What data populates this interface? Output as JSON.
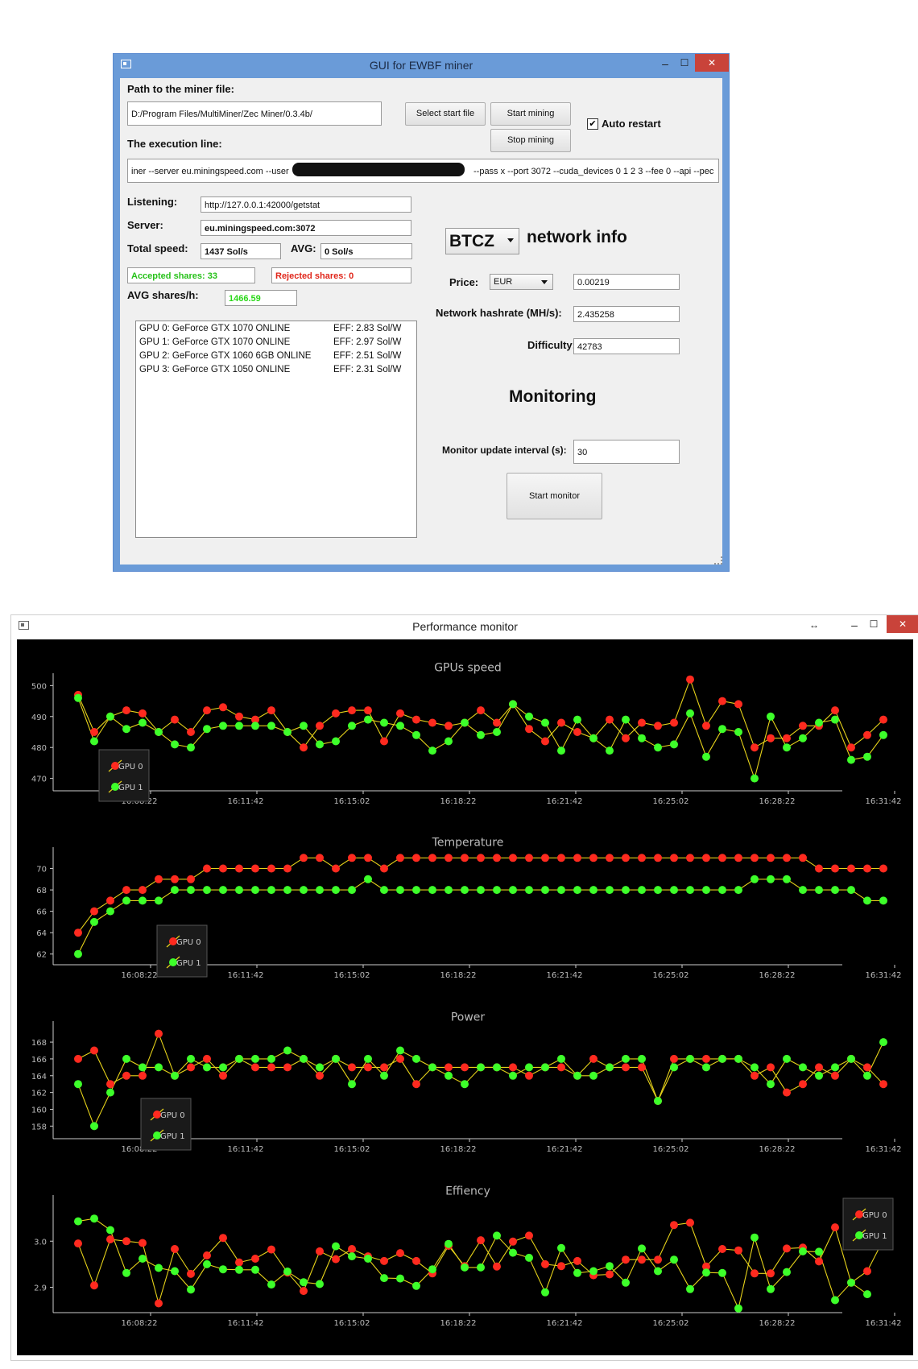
{
  "miner_window": {
    "title": "GUI for EWBF miner",
    "controls": {
      "minimize": "–",
      "maximize": "☐",
      "close": "✕"
    },
    "path_label": "Path to the miner file:",
    "path_value": "D:/Program Files/MultiMiner/Zec Miner/0.3.4b/",
    "select_file_button": "Select start file",
    "start_mining_button": "Start mining",
    "stop_mining_button": "Stop mining",
    "auto_restart_label": "Auto restart",
    "auto_restart_checked": "✔",
    "exec_label": "The execution line:",
    "exec_value_left": "iner --server eu.miningspeed.com --user",
    "exec_value_right": "--pass x --port 3072 --cuda_devices 0 1 2 3 --fee 0 --api --pec",
    "listening_label": "Listening:",
    "listening_value": "http://127.0.0.1:42000/getstat",
    "server_label": "Server:",
    "server_value": "eu.miningspeed.com:3072",
    "total_speed_label": "Total speed:",
    "total_speed_value": "1437 Sol/s",
    "avg_label": "AVG:",
    "avg_value": "0 Sol/s",
    "accepted_shares": "Accepted shares: 33",
    "rejected_shares": "Rejected shares: 0",
    "avg_shares_label": "AVG shares/h:",
    "avg_shares_value": "1466.59",
    "gpu_list": [
      {
        "name": "GPU 0: GeForce GTX 1070 ONLINE",
        "eff": "EFF: 2.83 Sol/W"
      },
      {
        "name": "GPU 1: GeForce GTX 1070 ONLINE",
        "eff": "EFF: 2.97 Sol/W"
      },
      {
        "name": "GPU 2: GeForce GTX 1060 6GB ONLINE",
        "eff": "EFF: 2.51 Sol/W"
      },
      {
        "name": "GPU 3: GeForce GTX 1050 ONLINE",
        "eff": "EFF: 2.31 Sol/W"
      }
    ],
    "coin_value": "BTCZ",
    "network_info_label": "network info",
    "price_label": "Price:",
    "currency_value": "EUR",
    "price_value": "0.00219",
    "hashrate_label": "Network hashrate (MH/s):",
    "hashrate_value": "2.435258",
    "difficulty_label": "Difficulty:",
    "difficulty_value": "42783",
    "monitoring_title": "Monitoring",
    "interval_label": "Monitor update interval (s):",
    "interval_value": "30",
    "start_monitor_button": "Start monitor"
  },
  "monitor_window": {
    "title": "Performance monitor",
    "controls": {
      "resize": "↔",
      "minimize": "–",
      "maximize": "☐",
      "close": "✕"
    }
  },
  "colors": {
    "gpu0": "#ff2a1f",
    "gpu1": "#3dff2a",
    "line": "#e6d21a",
    "titlebar_active": "#6a9bd8",
    "close": "#c9433a",
    "accepted_text": "#27c21a",
    "rejected_text": "#e0261a",
    "avg_shares_text": "#2bd81a"
  },
  "chart_data": [
    {
      "type": "line",
      "title": "GPUs speed",
      "x_tick_labels": [
        "16:08:22",
        "16:11:42",
        "16:15:02",
        "16:18:22",
        "16:21:42",
        "16:25:02",
        "16:28:22",
        "16:31:42"
      ],
      "y_tick_labels": [
        "500",
        "490",
        "480",
        "470"
      ],
      "ylim": [
        466,
        504
      ],
      "legend": "bottom-left",
      "series": [
        {
          "name": "GPU 0",
          "values": [
            497,
            485,
            490,
            492,
            491,
            485,
            489,
            485,
            492,
            493,
            490,
            489,
            492,
            485,
            480,
            487,
            491,
            492,
            492,
            482,
            491,
            489,
            488,
            487,
            488,
            492,
            488,
            494,
            486,
            482,
            488,
            485,
            483,
            489,
            483,
            488,
            487,
            488,
            502,
            487,
            495,
            494,
            480,
            483,
            483,
            487,
            487,
            492,
            480,
            484,
            489
          ]
        },
        {
          "name": "GPU 1",
          "values": [
            496,
            482,
            490,
            486,
            488,
            485,
            481,
            480,
            486,
            487,
            487,
            487,
            487,
            485,
            487,
            481,
            482,
            487,
            489,
            488,
            487,
            484,
            479,
            482,
            488,
            484,
            485,
            494,
            490,
            488,
            479,
            489,
            483,
            479,
            489,
            483,
            480,
            481,
            491,
            477,
            486,
            485,
            470,
            490,
            480,
            483,
            488,
            489,
            476,
            477,
            484
          ]
        }
      ]
    },
    {
      "type": "line",
      "title": "Temperature",
      "x_tick_labels": [
        "16:08:22",
        "16:11:42",
        "16:15:02",
        "16:18:22",
        "16:21:42",
        "16:25:02",
        "16:28:22",
        "16:31:42"
      ],
      "y_tick_labels": [
        "70",
        "68",
        "66",
        "64",
        "62"
      ],
      "ylim": [
        61,
        72
      ],
      "legend": "bottom-left",
      "series": [
        {
          "name": "GPU 0",
          "values": [
            64,
            66,
            67,
            68,
            68,
            69,
            69,
            69,
            70,
            70,
            70,
            70,
            70,
            70,
            71,
            71,
            70,
            71,
            71,
            70,
            71,
            71,
            71,
            71,
            71,
            71,
            71,
            71,
            71,
            71,
            71,
            71,
            71,
            71,
            71,
            71,
            71,
            71,
            71,
            71,
            71,
            71,
            71,
            71,
            71,
            71,
            70,
            70,
            70,
            70,
            70
          ]
        },
        {
          "name": "GPU 1",
          "values": [
            62,
            65,
            66,
            67,
            67,
            67,
            68,
            68,
            68,
            68,
            68,
            68,
            68,
            68,
            68,
            68,
            68,
            68,
            69,
            68,
            68,
            68,
            68,
            68,
            68,
            68,
            68,
            68,
            68,
            68,
            68,
            68,
            68,
            68,
            68,
            68,
            68,
            68,
            68,
            68,
            68,
            68,
            69,
            69,
            69,
            68,
            68,
            68,
            68,
            67,
            67
          ]
        }
      ]
    },
    {
      "type": "line",
      "title": "Power",
      "x_tick_labels": [
        "16:08:22",
        "16:11:42",
        "16:15:02",
        "16:18:22",
        "16:21:42",
        "16:25:02",
        "16:28:22",
        "16:31:42"
      ],
      "y_tick_labels": [
        "168",
        "166",
        "164",
        "162",
        "160",
        "158"
      ],
      "ylim": [
        156.5,
        170.5
      ],
      "legend": "bottom-left",
      "series": [
        {
          "name": "GPU 0",
          "values": [
            166,
            167,
            163,
            164,
            164,
            169,
            164,
            165,
            166,
            164,
            166,
            165,
            165,
            165,
            166,
            164,
            166,
            165,
            165,
            165,
            166,
            163,
            165,
            165,
            165,
            165,
            165,
            165,
            164,
            165,
            165,
            164,
            166,
            165,
            165,
            165,
            161,
            166,
            166,
            166,
            166,
            166,
            164,
            165,
            162,
            163,
            165,
            164,
            166,
            165,
            163
          ]
        },
        {
          "name": "GPU 1",
          "values": [
            163,
            158,
            162,
            166,
            165,
            165,
            164,
            166,
            165,
            165,
            166,
            166,
            166,
            167,
            166,
            165,
            166,
            163,
            166,
            164,
            167,
            166,
            165,
            164,
            163,
            165,
            165,
            164,
            165,
            165,
            166,
            164,
            164,
            165,
            166,
            166,
            161,
            165,
            166,
            165,
            166,
            166,
            165,
            163,
            166,
            165,
            164,
            165,
            166,
            164,
            168
          ]
        }
      ]
    },
    {
      "type": "line",
      "title": "Effiency",
      "x_tick_labels": [
        "16:08:22",
        "16:11:42",
        "16:15:02",
        "16:18:22",
        "16:21:42",
        "16:25:02",
        "16:28:22",
        "16:31:42"
      ],
      "y_tick_labels": [
        "3.0",
        "2.9"
      ],
      "ylim": [
        2.845,
        3.1
      ],
      "legend": "top-right",
      "series": [
        {
          "name": "GPU 0",
          "values": [
            2.995,
            2.904,
            3.004,
            3.0,
            2.996,
            2.865,
            2.983,
            2.929,
            2.969,
            3.007,
            2.954,
            2.962,
            2.982,
            2.932,
            2.892,
            2.978,
            2.961,
            2.983,
            2.967,
            2.957,
            2.974,
            2.957,
            2.93,
            2.99,
            2.946,
            3.002,
            2.945,
            2.999,
            3.012,
            2.95,
            2.946,
            2.957,
            2.926,
            2.928,
            2.96,
            2.96,
            2.96,
            3.035,
            3.04,
            2.945,
            2.983,
            2.98,
            2.93,
            2.93,
            2.984,
            2.986,
            2.956,
            3.03,
            2.91,
            2.935,
            3.003
          ]
        },
        {
          "name": "GPU 1",
          "values": [
            3.043,
            3.049,
            3.024,
            2.931,
            2.962,
            2.942,
            2.935,
            2.895,
            2.95,
            2.939,
            2.938,
            2.938,
            2.906,
            2.934,
            2.911,
            2.907,
            2.989,
            2.967,
            2.962,
            2.92,
            2.919,
            2.903,
            2.939,
            2.994,
            2.943,
            2.943,
            3.012,
            2.975,
            2.964,
            2.889,
            2.985,
            2.931,
            2.935,
            2.946,
            2.91,
            2.984,
            2.935,
            2.96,
            2.896,
            2.932,
            2.931,
            2.854,
            3.008,
            2.896,
            2.933,
            2.978,
            2.977,
            2.872,
            2.91,
            2.885
          ]
        }
      ]
    }
  ]
}
